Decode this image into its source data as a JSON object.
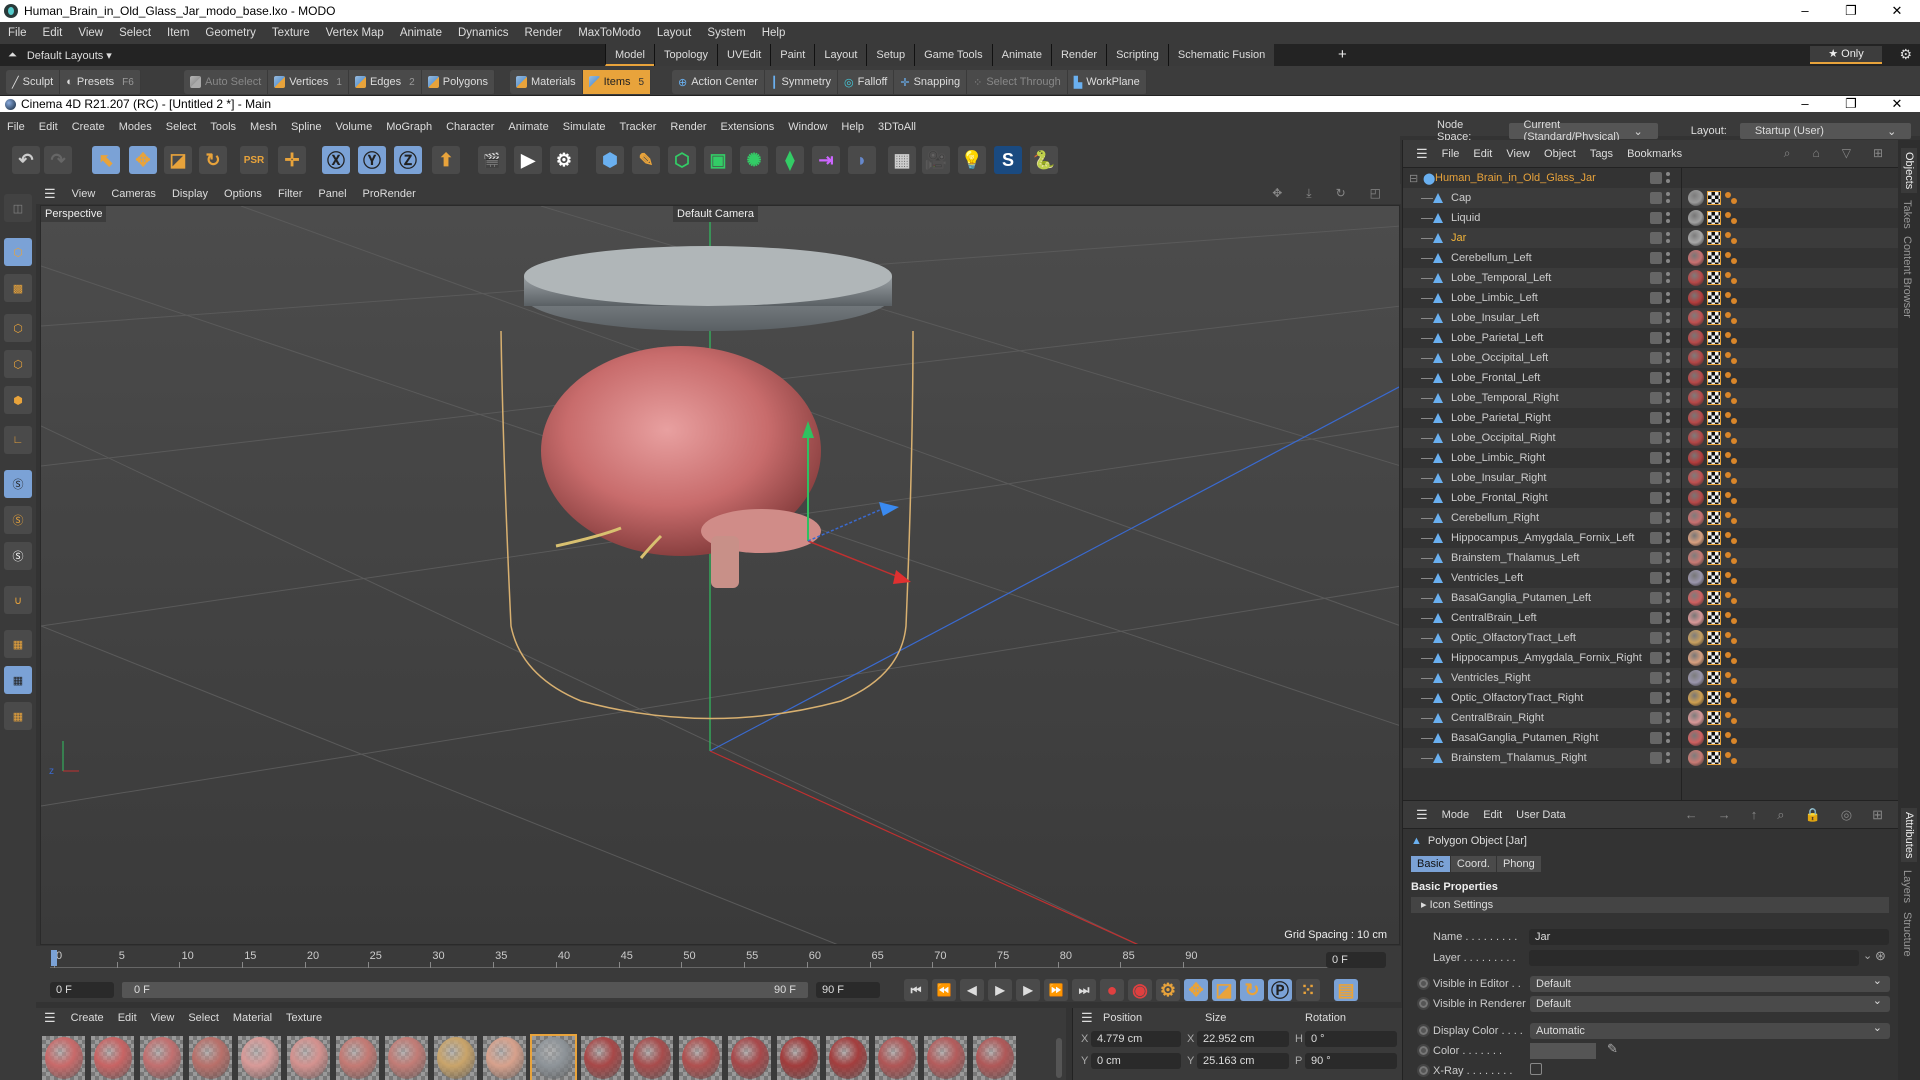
{
  "modo": {
    "window_title": "Human_Brain_in_Old_Glass_Jar_modo_base.lxo - MODO",
    "menu": [
      "File",
      "Edit",
      "View",
      "Select",
      "Item",
      "Geometry",
      "Texture",
      "Vertex Map",
      "Animate",
      "Dynamics",
      "Render",
      "MaxToModo",
      "Layout",
      "System",
      "Help"
    ],
    "layouts_label": "Default Layouts ▾",
    "tabs": [
      "Model",
      "Topology",
      "UVEdit",
      "Paint",
      "Layout",
      "Setup",
      "Game Tools",
      "Animate",
      "Render",
      "Scripting",
      "Schematic Fusion"
    ],
    "active_tab": "Model",
    "add_tab": "+",
    "only_label": "★ Only",
    "toolbar": {
      "sculpt": "Sculpt",
      "presets": "Presets",
      "presets_key": "F6",
      "auto_select": "Auto Select",
      "vertices": "Vertices",
      "vertices_key": "1",
      "edges": "Edges",
      "edges_key": "2",
      "polygons": "Polygons",
      "materials": "Materials",
      "items": "Items",
      "items_key": "5",
      "action_center": "Action Center",
      "symmetry": "Symmetry",
      "falloff": "Falloff",
      "snapping": "Snapping",
      "select_through": "Select Through",
      "workplane": "WorkPlane"
    }
  },
  "c4d": {
    "window_title": "Cinema 4D R21.207 (RC) - [Untitled 2 *] - Main",
    "menu": [
      "File",
      "Edit",
      "Create",
      "Modes",
      "Select",
      "Tools",
      "Mesh",
      "Spline",
      "Volume",
      "MoGraph",
      "Character",
      "Animate",
      "Simulate",
      "Tracker",
      "Render",
      "Extensions",
      "Window",
      "Help",
      "3DToAll"
    ],
    "node_space_label": "Node Space:",
    "node_space_value": "Current (Standard/Physical)",
    "layout_label": "Layout:",
    "layout_value": "Startup (User)"
  },
  "viewport": {
    "menu": [
      "View",
      "Cameras",
      "Display",
      "Options",
      "Filter",
      "Panel",
      "ProRender"
    ],
    "view_name": "Perspective",
    "camera_label": "Default Camera",
    "grid_spacing": "Grid Spacing : 10 cm"
  },
  "timeline": {
    "ticks": [
      "0",
      "5",
      "10",
      "15",
      "20",
      "25",
      "30",
      "35",
      "40",
      "45",
      "50",
      "55",
      "60",
      "65",
      "70",
      "75",
      "80",
      "85",
      "90"
    ],
    "current_frame": "0 F",
    "start_field": "0 F",
    "range_start": "0 F",
    "range_end": "90 F",
    "end_field": "90 F",
    "frame_right": "0 F"
  },
  "material_manager": {
    "menu": [
      "Create",
      "Edit",
      "View",
      "Select",
      "Material",
      "Texture"
    ],
    "materials": [
      {
        "tone": "#c96a6a"
      },
      {
        "tone": "#c86464"
      },
      {
        "tone": "#c27070"
      },
      {
        "tone": "#b9706a"
      },
      {
        "tone": "#d89a98"
      },
      {
        "tone": "#d4928f"
      },
      {
        "tone": "#c47a74"
      },
      {
        "tone": "#c27c76"
      },
      {
        "tone": "#c9a46a"
      },
      {
        "tone": "#d7a18c"
      },
      {
        "tone": "#8e9499",
        "selected": true
      },
      {
        "tone": "#a84848"
      },
      {
        "tone": "#a84c4c"
      },
      {
        "tone": "#b0504f"
      },
      {
        "tone": "#a8484a"
      },
      {
        "tone": "#a23c3c"
      },
      {
        "tone": "#a43e3e"
      },
      {
        "tone": "#b05656"
      },
      {
        "tone": "#b45c5c"
      },
      {
        "tone": "#b05858"
      }
    ]
  },
  "coords": {
    "headers": [
      "Position",
      "Size",
      "Rotation"
    ],
    "rows": [
      {
        "axis1": "X",
        "pos": "4.779 cm",
        "axis2": "X",
        "size": "22.952 cm",
        "axis3": "H",
        "rot": "0 °"
      },
      {
        "axis1": "Y",
        "pos": "0 cm",
        "axis2": "Y",
        "size": "25.163 cm",
        "axis3": "P",
        "rot": "90 °"
      }
    ]
  },
  "object_manager": {
    "menu": [
      "File",
      "Edit",
      "View",
      "Object",
      "Tags",
      "Bookmarks"
    ],
    "root": "Human_Brain_in_Old_Glass_Jar",
    "objects": [
      {
        "name": "Cap",
        "mat": "#9a9a9a"
      },
      {
        "name": "Liquid",
        "mat": "#a0a0a0"
      },
      {
        "name": "Jar",
        "mat": "#a8a8a8",
        "selected": true
      },
      {
        "name": "Cerebellum_Left",
        "mat": "#c87070"
      },
      {
        "name": "Lobe_Temporal_Left",
        "mat": "#b84848"
      },
      {
        "name": "Lobe_Limbic_Left",
        "mat": "#b43c3c"
      },
      {
        "name": "Lobe_Insular_Left",
        "mat": "#c05050"
      },
      {
        "name": "Lobe_Parietal_Left",
        "mat": "#b84a4a"
      },
      {
        "name": "Lobe_Occipital_Left",
        "mat": "#b44646"
      },
      {
        "name": "Lobe_Frontal_Left",
        "mat": "#b84848"
      },
      {
        "name": "Lobe_Temporal_Right",
        "mat": "#b84848"
      },
      {
        "name": "Lobe_Parietal_Right",
        "mat": "#b84a4a"
      },
      {
        "name": "Lobe_Occipital_Right",
        "mat": "#b44646"
      },
      {
        "name": "Lobe_Limbic_Right",
        "mat": "#b43c3c"
      },
      {
        "name": "Lobe_Insular_Right",
        "mat": "#c05050"
      },
      {
        "name": "Lobe_Frontal_Right",
        "mat": "#b84848"
      },
      {
        "name": "Cerebellum_Right",
        "mat": "#c87070"
      },
      {
        "name": "Hippocampus_Amygdala_Fornix_Left",
        "mat": "#d8a080"
      },
      {
        "name": "Brainstem_Thalamus_Left",
        "mat": "#c87a74"
      },
      {
        "name": "Ventricles_Left",
        "mat": "#9a96ac"
      },
      {
        "name": "BasalGanglia_Putamen_Left",
        "mat": "#d06060"
      },
      {
        "name": "CentralBrain_Left",
        "mat": "#d89898"
      },
      {
        "name": "Optic_OlfactoryTract_Left",
        "mat": "#c8a060"
      },
      {
        "name": "Hippocampus_Amygdala_Fornix_Right",
        "mat": "#d8a080"
      },
      {
        "name": "Ventricles_Right",
        "mat": "#9a96ac"
      },
      {
        "name": "Optic_OlfactoryTract_Right",
        "mat": "#d0a050"
      },
      {
        "name": "CentralBrain_Right",
        "mat": "#d89898"
      },
      {
        "name": "BasalGanglia_Putamen_Right",
        "mat": "#d06060"
      },
      {
        "name": "Brainstem_Thalamus_Right",
        "mat": "#c87a74"
      }
    ]
  },
  "attributes": {
    "menu": [
      "Mode",
      "Edit",
      "User Data"
    ],
    "object_title": "Polygon Object [Jar]",
    "tabs": [
      "Basic",
      "Coord.",
      "Phong"
    ],
    "active_tab": "Basic",
    "section": "Basic Properties",
    "icon_settings": "Icon Settings",
    "name_label": "Name . . . . . . . . .",
    "name_value": "Jar",
    "layer_label": "Layer . . . . . . . . .",
    "layer_value": "",
    "visible_editor_label": "Visible in Editor . .",
    "visible_editor_value": "Default",
    "visible_renderer_label": "Visible in Renderer",
    "visible_renderer_value": "Default",
    "display_color_label": "Display Color . . . .",
    "display_color_value": "Automatic",
    "color_label": "Color . . . . . . .",
    "xray_label": "X-Ray . . . . . . . .",
    "xray_checked": false
  },
  "side_tabs": {
    "top": [
      "Objects",
      "Takes",
      "Content Browser"
    ],
    "bottom": [
      "Attributes",
      "Layers",
      "Structure"
    ]
  }
}
